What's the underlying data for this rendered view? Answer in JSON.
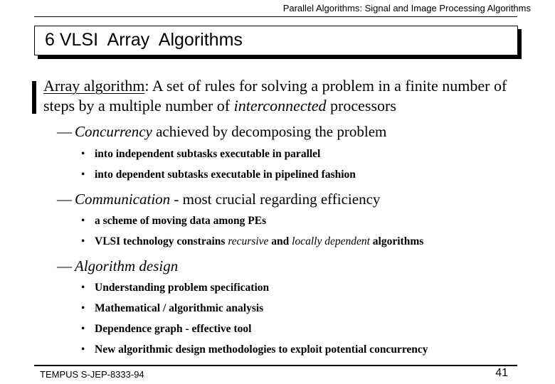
{
  "header": {
    "title": "Parallel Algorithms:  Signal and Image Processing Algorithms"
  },
  "slide": {
    "title": "6 VLSI  Array  Algorithms",
    "definition": {
      "term": "Array algorithm",
      "text_part1": ": A set of rules for solving a problem in a finite number of steps by a multiple number of ",
      "emphasis": "interconnected",
      "text_part2": " processors"
    },
    "sections": [
      {
        "dash": "—",
        "lead": "Concurrency",
        "rest": " achieved by decomposing the problem",
        "bullets": [
          {
            "dot": "•",
            "text": "into independent subtasks executable in parallel"
          },
          {
            "dot": "•",
            "text": "into dependent subtasks executable in pipelined fashion"
          }
        ]
      },
      {
        "dash": "—",
        "lead": "Communication",
        "rest": " - most crucial regarding efficiency",
        "bullets": [
          {
            "dot": "•",
            "text": "a scheme of moving data among  PEs"
          },
          {
            "dot": "•",
            "text_a": "VLSI  technology constrains ",
            "it_a": "recursive",
            "text_b": " and ",
            "it_b": "locally dependent",
            "text_c": "  algorithms"
          }
        ]
      },
      {
        "dash": "—",
        "lead": "Algorithm design",
        "rest": "",
        "bullets": [
          {
            "dot": "•",
            "text": "Understanding problem specification"
          },
          {
            "dot": "•",
            "text": "Mathematical / algorithmic analysis"
          },
          {
            "dot": "•",
            "text": "Dependence graph - effective tool"
          },
          {
            "dot": "•",
            "text": "New algorithmic design methodologies to exploit potential concurrency"
          }
        ]
      }
    ]
  },
  "footer": {
    "left": "TEMPUS S-JEP-8333-94",
    "page_number": "41"
  }
}
